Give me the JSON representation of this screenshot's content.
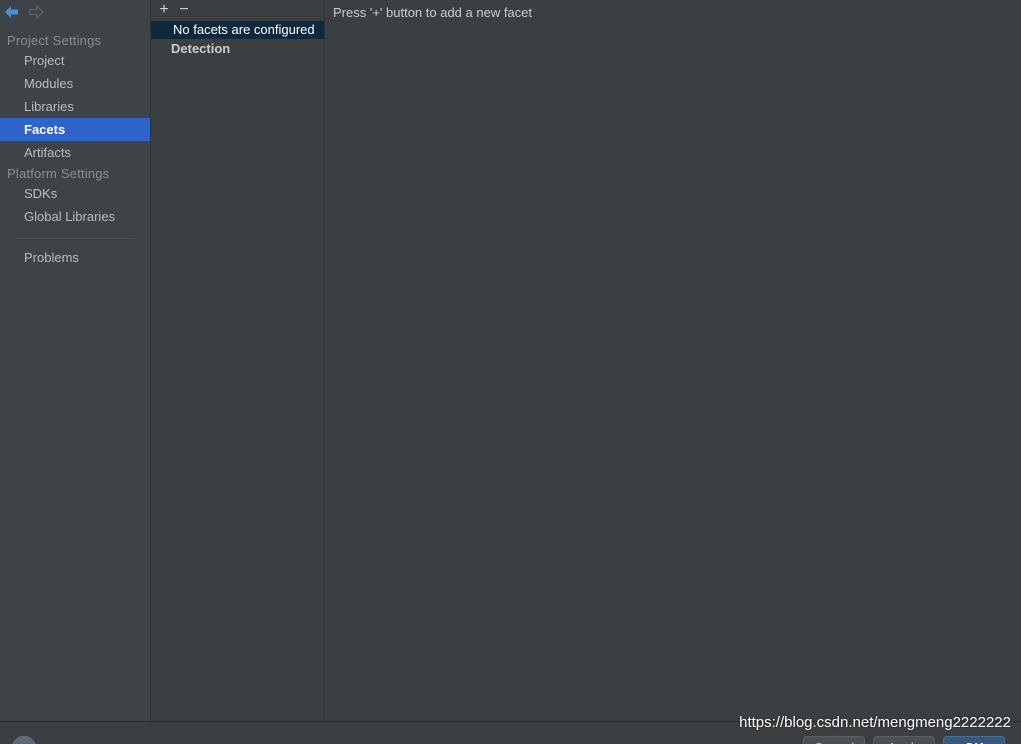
{
  "sidebar": {
    "project_settings_label": "Project Settings",
    "platform_settings_label": "Platform Settings",
    "items": [
      {
        "label": "Project"
      },
      {
        "label": "Modules"
      },
      {
        "label": "Libraries"
      },
      {
        "label": "Facets"
      },
      {
        "label": "Artifacts"
      },
      {
        "label": "SDKs"
      },
      {
        "label": "Global Libraries"
      },
      {
        "label": "Problems"
      }
    ],
    "selected": "Facets"
  },
  "middle": {
    "toolbar": {
      "add_symbol": "+",
      "remove_symbol": "−"
    },
    "rows": [
      {
        "label": "No facets are configured"
      },
      {
        "label": "Detection"
      }
    ]
  },
  "content": {
    "hint": "Press '+' button to add a new facet"
  },
  "footer": {
    "cancel_label": "Cancel",
    "apply_label": "Apply",
    "ok_label": "OK"
  },
  "watermark": "https://blog.csdn.net/mengmeng2222222",
  "colors": {
    "selection": "#2f65ca",
    "list_selection": "#0d293e",
    "background": "#3c3f41",
    "sidebar": "#3e4347"
  },
  "icons": {
    "back": "arrow-left-icon",
    "forward": "arrow-right-icon",
    "add": "plus-icon",
    "remove": "minus-icon",
    "help": "help-icon"
  }
}
